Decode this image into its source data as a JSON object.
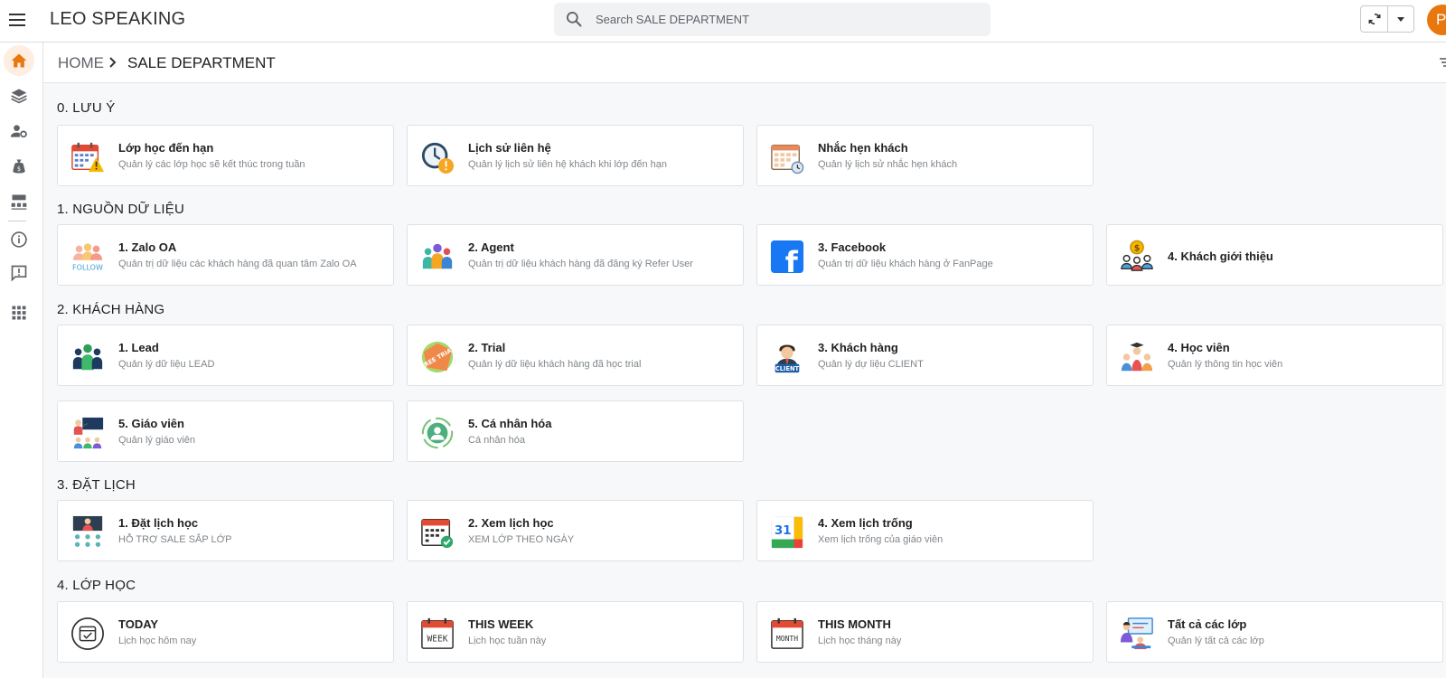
{
  "app": {
    "title": "LEO SPEAKING",
    "avatar_initial": "P",
    "accent": "#e8770e"
  },
  "search": {
    "placeholder": "Search SALE DEPARTMENT"
  },
  "breadcrumb": {
    "home": "HOME",
    "current": "SALE DEPARTMENT"
  },
  "sidebar": [
    {
      "icon": "home-icon",
      "active": true
    },
    {
      "icon": "layers-icon"
    },
    {
      "icon": "user-settings-icon"
    },
    {
      "icon": "money-bag-icon"
    },
    {
      "icon": "sitemap-icon"
    },
    {
      "icon": "info-icon"
    },
    {
      "icon": "feedback-icon"
    },
    {
      "icon": "apps-grid-icon"
    }
  ],
  "sections": [
    {
      "title": "0. LƯU Ý",
      "cards": [
        {
          "title": "Lớp học đến hạn",
          "desc": "Quản lý các lớp học sẽ kết thúc trong tuần",
          "icon": "calendar-warning-icon"
        },
        {
          "title": "Lịch sử liên hệ",
          "desc": "Quản lý lịch sử liên hệ khách khi lớp đến hạn",
          "icon": "clock-alert-icon"
        },
        {
          "title": "Nhắc hẹn khách",
          "desc": "Quản lý lịch sử nhắc hẹn khách",
          "icon": "calendar-clock-icon"
        }
      ]
    },
    {
      "title": "1. NGUỒN DỮ LIỆU",
      "cards": [
        {
          "title": "1. Zalo OA",
          "desc": "Quản trị dữ liệu các khách hàng đã quan tâm Zalo OA",
          "icon": "zalo-follow-icon",
          "icon_text": "FOLLOW"
        },
        {
          "title": "2. Agent",
          "desc": "Quản trị dữ liệu khách hàng đã đăng ký Refer User",
          "icon": "agent-group-icon"
        },
        {
          "title": "3. Facebook",
          "desc": "Quản trị dữ liệu khách hàng ở FanPage",
          "icon": "facebook-icon",
          "icon_text": "f"
        },
        {
          "title": "4. Khách giới thiệu",
          "desc": "",
          "icon": "referral-coin-icon",
          "icon_text": "$"
        }
      ]
    },
    {
      "title": "2. KHÁCH HÀNG",
      "cards": [
        {
          "title": "1. Lead",
          "desc": "Quản lý dữ liệu LEAD",
          "icon": "lead-group-icon"
        },
        {
          "title": "2. Trial",
          "desc": "Quản lý dữ liệu khách hàng đã học trial",
          "icon": "free-trial-icon",
          "icon_text": "FREE TRIAL"
        },
        {
          "title": "3. Khách hàng",
          "desc": "Quản lý dự liệu CLIENT",
          "icon": "client-icon",
          "icon_text": "CLIENT"
        },
        {
          "title": "4. Học viên",
          "desc": "Quản lý thông tin học viên",
          "icon": "student-group-icon"
        },
        {
          "title": "5. Giáo viên",
          "desc": "Quản lý giáo viên",
          "icon": "teacher-icon"
        },
        {
          "title": "5. Cá nhân hóa",
          "desc": "Cá nhân hóa",
          "icon": "personalize-icon"
        }
      ]
    },
    {
      "title": "3. ĐẶT LỊCH",
      "cards": [
        {
          "title": "1. Đặt lịch học",
          "desc": "HỖ TRỢ SALE SẮP LỚP",
          "icon": "schedule-class-icon"
        },
        {
          "title": "2. Xem lịch học",
          "desc": "XEM LỚP THEO NGÀY",
          "icon": "calendar-check-icon"
        },
        {
          "title": "4. Xem lịch trống",
          "desc": "Xem lịch trống của giáo viên",
          "icon": "google-calendar-icon",
          "icon_text": "31"
        }
      ]
    },
    {
      "title": "4. LỚP HỌC",
      "cards": [
        {
          "title": "TODAY",
          "desc": "Lịch học hôm nay",
          "icon": "today-calendar-icon"
        },
        {
          "title": "THIS WEEK",
          "desc": "Lịch học tuần này",
          "icon": "week-calendar-icon",
          "icon_text": "WEEK"
        },
        {
          "title": "THIS MONTH",
          "desc": "Lịch học tháng này",
          "icon": "month-calendar-icon",
          "icon_text": "MONTH"
        },
        {
          "title": "Tất cả các lớp",
          "desc": "Quản lý tất cả các lớp",
          "icon": "all-classes-icon"
        }
      ]
    }
  ]
}
